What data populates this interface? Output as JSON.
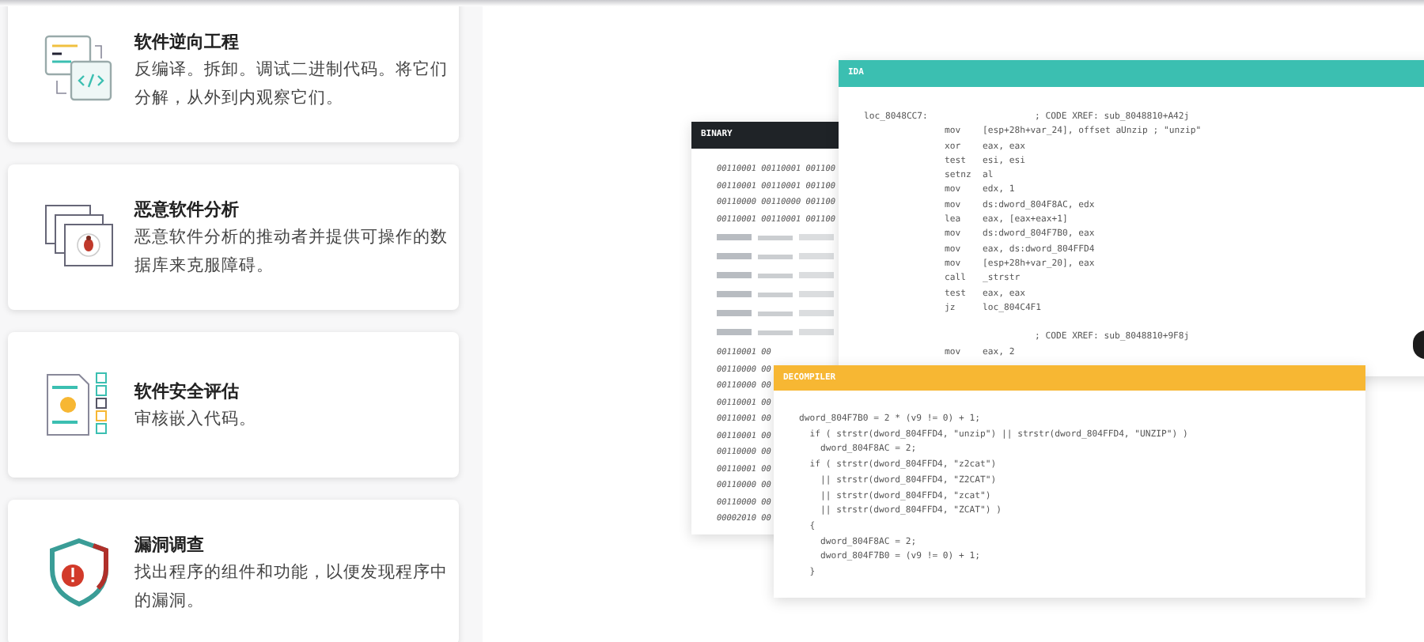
{
  "features": [
    {
      "kind": "code",
      "title": "软件逆向工程",
      "description": "反编译。拆卸。调试二进制代码。将它们分解，从外到内观察它们。"
    },
    {
      "kind": "malware",
      "title": "恶意软件分析",
      "description": "恶意软件分析的推动者并提供可操作的数据库来克服障碍。"
    },
    {
      "kind": "checklist",
      "title": "软件安全评估",
      "description": "审核嵌入代码。"
    },
    {
      "kind": "shield",
      "title": "漏洞调查",
      "description": "找出程序的组件和功能，以便发现程序中的漏洞。"
    }
  ],
  "binary": {
    "title": "BINARY",
    "rows": [
      {
        "kind": "text",
        "text": "00110001 00110001 001100"
      },
      {
        "kind": "text",
        "text": "00110001 00110001 001100"
      },
      {
        "kind": "text",
        "text": "00110000 00110000 001100"
      },
      {
        "kind": "text",
        "text": "00110001 00110001 001100"
      },
      {
        "kind": "garbled"
      },
      {
        "kind": "text",
        "text": "00110001 00"
      },
      {
        "kind": "text",
        "text": "00110000 00"
      },
      {
        "kind": "text",
        "text": "00110000 00"
      },
      {
        "kind": "text",
        "text": "00110001 00"
      },
      {
        "kind": "text",
        "text": "00110001 00"
      },
      {
        "kind": "text",
        "text": "00110001 00"
      },
      {
        "kind": "text",
        "text": "00110000 00"
      },
      {
        "kind": "text",
        "text": "00110001 00"
      },
      {
        "kind": "text",
        "text": "00110000 00"
      },
      {
        "kind": "text",
        "text": "00110000 00"
      },
      {
        "kind": "text",
        "text": "00002010 00"
      }
    ]
  },
  "ida": {
    "title": "IDA",
    "lines": [
      {
        "kind": "label",
        "label": "loc_8048CC7:",
        "comment": "; CODE XREF: sub_8048810+A42j"
      },
      {
        "kind": "op",
        "mnemonic": "mov",
        "operand": "[esp+28h+var_24], offset aUnzip ; \"unzip\""
      },
      {
        "kind": "op",
        "mnemonic": "xor",
        "operand": "eax, eax"
      },
      {
        "kind": "op",
        "mnemonic": "test",
        "operand": "esi, esi"
      },
      {
        "kind": "op",
        "mnemonic": "setnz",
        "operand": "al"
      },
      {
        "kind": "op",
        "mnemonic": "mov",
        "operand": "edx, 1"
      },
      {
        "kind": "op",
        "mnemonic": "mov",
        "operand": "ds:dword_804F8AC, edx"
      },
      {
        "kind": "op",
        "mnemonic": "lea",
        "operand": "eax, [eax+eax+1]"
      },
      {
        "kind": "op",
        "mnemonic": "mov",
        "operand": "ds:dword_804F7B0, eax"
      },
      {
        "kind": "op",
        "mnemonic": "mov",
        "operand": "eax, ds:dword_804FFD4"
      },
      {
        "kind": "op",
        "mnemonic": "mov",
        "operand": "[esp+28h+var_20], eax"
      },
      {
        "kind": "op",
        "mnemonic": "call",
        "operand": "_strstr"
      },
      {
        "kind": "op",
        "mnemonic": "test",
        "operand": "eax, eax"
      },
      {
        "kind": "op",
        "mnemonic": "jz",
        "operand": "loc_804C4F1"
      },
      {
        "kind": "blank"
      },
      {
        "kind": "label",
        "comment": "; CODE XREF: sub_8048810+9F8j"
      },
      {
        "kind": "op",
        "mnemonic": "mov",
        "operand": "eax, 2"
      }
    ]
  },
  "decompiler": {
    "title": "DECOMPILER",
    "lines": [
      "dword_804F7B0 = 2 * (v9 != 0) + 1;",
      "  if ( strstr(dword_804FFD4, \"unzip\") || strstr(dword_804FFD4, \"UNZIP\") )",
      "    dword_804F8AC = 2;",
      "  if ( strstr(dword_804FFD4, \"z2cat\")",
      "    || strstr(dword_804FFD4, \"Z2CAT\")",
      "    || strstr(dword_804FFD4, \"zcat\")",
      "    || strstr(dword_804FFD4, \"ZCAT\") )",
      "  {",
      "    dword_804F8AC = 2;",
      "    dword_804F7B0 = (v9 != 0) + 1;",
      "  }"
    ]
  }
}
